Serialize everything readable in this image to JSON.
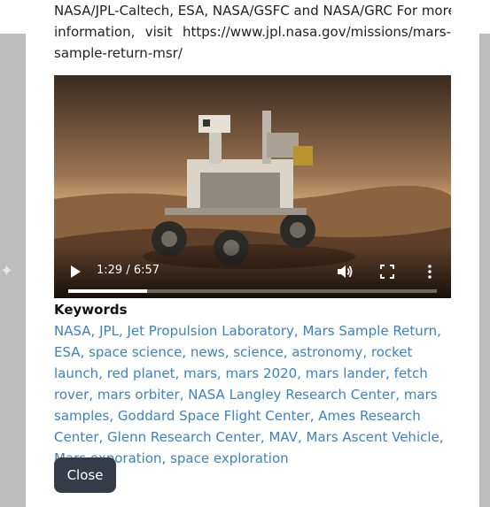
{
  "description_lines": [
    "NASA/JPL-Caltech, ESA, NASA/GSFC and NASA/GRC For more",
    "information,     visit     https://www.jpl.nasa.gov/missions/mars-",
    "sample-return-msr/"
  ],
  "video": {
    "time_display": "1:29 / 6:57",
    "progress_fraction": 0.2134
  },
  "keywords_heading": "Keywords",
  "keywords": [
    "NASA",
    "JPL",
    "Jet Propulsion Laboratory",
    "Mars Sample Return",
    "ESA",
    "space science",
    "news",
    "science",
    "astronomy",
    "rocket launch",
    "red planet",
    "mars",
    "mars 2020",
    "mars lander",
    "fetch rover",
    "mars orbiter",
    "NASA Langley Research Center",
    "mars samples",
    "Goddard Space Flight Center",
    "Ames Research Center",
    "Glenn Research Center",
    "MAV",
    "Mars Ascent Vehicle",
    "Mars exporation",
    "space exploration"
  ],
  "close_label": "Close",
  "colors": {
    "link": "#3b82c4",
    "close_button": "#353c48",
    "backdrop": "#bdbdbd"
  },
  "icons": [
    "play-icon",
    "volume-icon",
    "fullscreen-icon",
    "more-vertical-icon"
  ]
}
